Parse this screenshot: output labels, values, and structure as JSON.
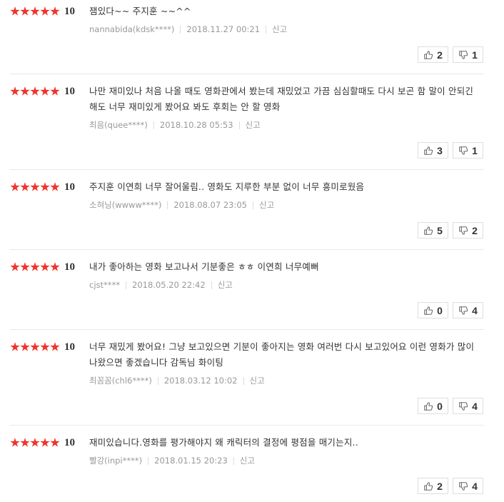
{
  "reviews": [
    {
      "score": "10",
      "text": "잼있다~~ 주지훈 ~~^^",
      "author": "nannabida(kdsk****)",
      "date": "2018.11.27 00:21",
      "report": "신고",
      "up": "2",
      "down": "1"
    },
    {
      "score": "10",
      "text": "나만 재미있나 처음 나올 때도 영화관에서 봤는데 재밌었고 가끔 심심할때도 다시 보곤 함 말이 안되긴해도 너무 재미있게 봤어요 봐도 후회는 안 할 영화",
      "author": "최음(quee****)",
      "date": "2018.10.28 05:53",
      "report": "신고",
      "up": "3",
      "down": "1"
    },
    {
      "score": "10",
      "text": "주지훈 이연희 너무 잘어울림.. 영화도 지루한 부분 없이 너무 흥미로웠음",
      "author": "소혀닝(wwww****)",
      "date": "2018.08.07 23:05",
      "report": "신고",
      "up": "5",
      "down": "2"
    },
    {
      "score": "10",
      "text": "내가 좋아하는 영화 보고나서 기분좋은 ㅎㅎ 이연희 너무예뻐",
      "author": "cjst****",
      "date": "2018.05.20 22:42",
      "report": "신고",
      "up": "0",
      "down": "4"
    },
    {
      "score": "10",
      "text": "너무 재밌게 봤어요! 그냥 보고있으면 기분이 좋아지는 영화 여러번 다시 보고있어요 이런 영화가 많이 나왔으면 좋겠습니다 감독님 화이팅",
      "author": "최꼼꼼(chl6****)",
      "date": "2018.03.12 10:02",
      "report": "신고",
      "up": "0",
      "down": "4"
    },
    {
      "score": "10",
      "text": "재미있습니다.영화를 평가해야지 왜 캐릭터의 결정에 평점을 매기는지..",
      "author": "빨강(inpi****)",
      "date": "2018.01.15 20:23",
      "report": "신고",
      "up": "2",
      "down": "4"
    }
  ],
  "colors": {
    "star": "#f0332c",
    "divider": "#e9e9e9",
    "meta": "#999999"
  },
  "icons": {
    "up": "thumbs-up-icon",
    "down": "thumbs-down-icon"
  }
}
